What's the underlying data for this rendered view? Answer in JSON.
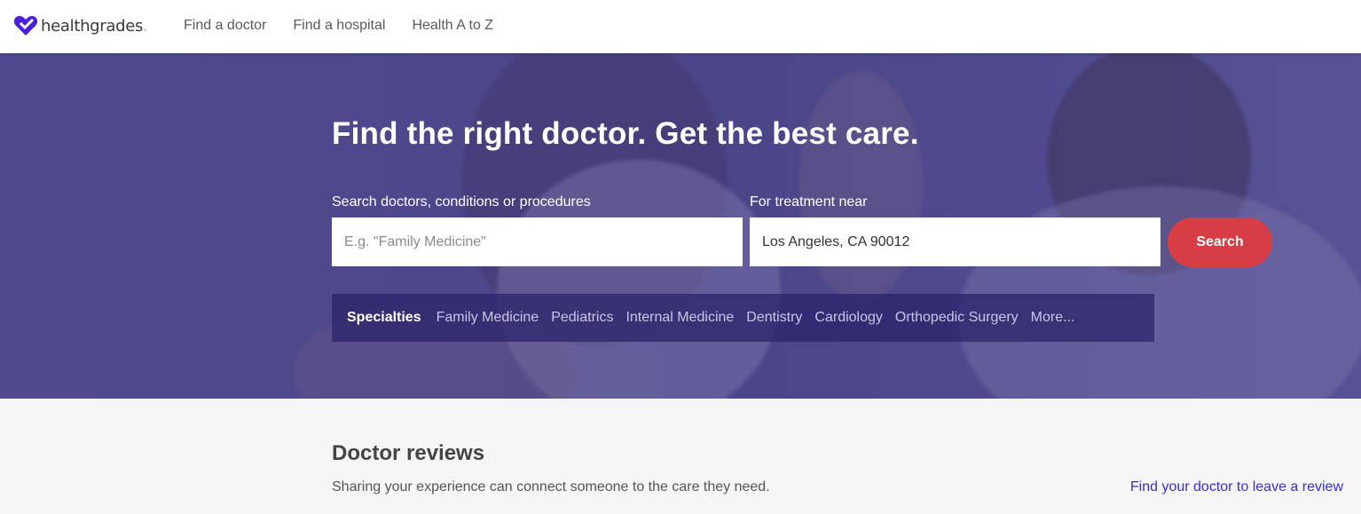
{
  "header": {
    "logo_text": "healthgrades",
    "logo_dot": ".",
    "nav": [
      {
        "label": "Find a doctor"
      },
      {
        "label": "Find a hospital"
      },
      {
        "label": "Health A to Z"
      }
    ]
  },
  "hero": {
    "title": "Find the right doctor. Get the best care.",
    "search": {
      "label": "Search doctors, conditions or procedures",
      "placeholder": "E.g. \"Family Medicine\"",
      "value": ""
    },
    "location": {
      "label": "For treatment near",
      "value": "Los Angeles, CA 90012"
    },
    "search_button": "Search",
    "specialties": {
      "heading": "Specialties",
      "items": [
        {
          "label": "Family Medicine"
        },
        {
          "label": "Pediatrics"
        },
        {
          "label": "Internal Medicine"
        },
        {
          "label": "Dentistry"
        },
        {
          "label": "Cardiology"
        },
        {
          "label": "Orthopedic Surgery"
        },
        {
          "label": "More..."
        }
      ]
    }
  },
  "reviews": {
    "title": "Doctor reviews",
    "subtitle": "Sharing your experience can connect someone to the care they need.",
    "link": "Find your doctor to leave a review"
  },
  "colors": {
    "brand_purple": "#4b20d6",
    "search_button": "#d63d45",
    "link": "#3b2fc9"
  }
}
